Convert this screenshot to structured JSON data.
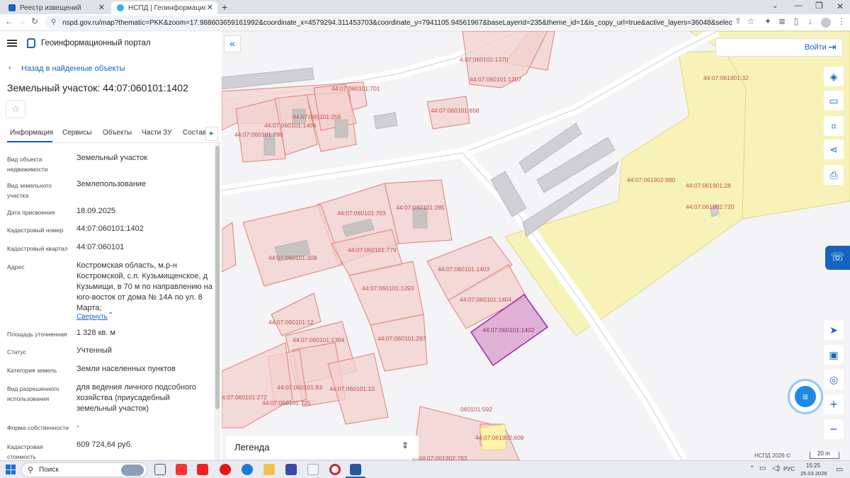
{
  "browser": {
    "tabs": [
      {
        "title": "Реестр извещений",
        "active": false
      },
      {
        "title": "НСПД | Геоинформационный п",
        "active": true
      }
    ],
    "new_tab": "+",
    "url": "nspd.gov.ru/map?thematic=PKK&zoom=17.988603659161992&coordinate_x=4579294.311453703&coordinate_y=7941105.94561967&baseLayerId=235&theme_id=1&is_copy_url=true&active_layers=36048&selectedCard=1084404139%2C3..."
  },
  "header": {
    "title": "Геоинформационный портал",
    "back_link": "Назад в найденные объекты",
    "object_title": "Земельный участок: 44:07:060101:1402",
    "login": "Войти"
  },
  "tabs": [
    {
      "label": "Информация",
      "active": true
    },
    {
      "label": "Сервисы"
    },
    {
      "label": "Объекты"
    },
    {
      "label": "Части ЗУ"
    },
    {
      "label": "Состав"
    }
  ],
  "fields": [
    {
      "label": "Вид объекта недвижимости",
      "value": "Земельный участок"
    },
    {
      "label": "Вид земельного участка",
      "value": "Землепользование"
    },
    {
      "label": "Дата присвоения",
      "value": "18.09.2025"
    },
    {
      "label": "Кадастровый номер",
      "value": "44:07:060101:1402"
    },
    {
      "label": "Кадастровый квартал",
      "value": "44:07:060101"
    },
    {
      "label": "Адрес",
      "value": "Костромская область, м.р-н Костромской, с.п. Кузьмищенское, д Кузьмищи, в 70 м по направлению на юго-восток от дома № 14А по ул. 8 Марта;"
    },
    {
      "label": "Площадь уточненная",
      "value": "1 328 кв. м"
    },
    {
      "label": "Статус",
      "value": "Учтенный"
    },
    {
      "label": "Категория земель",
      "value": "Земли населенных пунктов"
    },
    {
      "label": "Вид разрешенного использования",
      "value": "для ведения личного подсобного хозяйства (приусадебный земельный участок)"
    },
    {
      "label": "Форма собственности",
      "value": "-"
    },
    {
      "label": "Кадастровая стоимость",
      "value": "609 724,64 руб."
    }
  ],
  "collapse_link": "Свернуть",
  "map": {
    "legend": "Легенда",
    "attribution": "НСПД 2026 ©",
    "scale": "20 m",
    "parcels": [
      {
        "id": "a1370",
        "label": "4:07:060101:1370"
      },
      {
        "id": "a1307",
        "label": "44:07:060101:1307"
      },
      {
        "id": "a701",
        "label": "44:07:060101:701"
      },
      {
        "id": "a256",
        "label": "44:07:060101:256"
      },
      {
        "id": "a1406",
        "label": "44:07:060101:1406"
      },
      {
        "id": "a786",
        "label": "44:07:060101:786"
      },
      {
        "id": "a658",
        "label": "44:07:060101:658"
      },
      {
        "id": "a32",
        "label": "44:07:061901:32"
      },
      {
        "id": "a980",
        "label": "44:07:061902:980"
      },
      {
        "id": "a28",
        "label": "44:07:061901:28"
      },
      {
        "id": "a720",
        "label": "44:07:061902:720"
      },
      {
        "id": "a703",
        "label": "44:07:060101:703"
      },
      {
        "id": "a285",
        "label": "44:07:060101:285"
      },
      {
        "id": "a308",
        "label": "44:07:060101:308"
      },
      {
        "id": "a779",
        "label": "44:07:060101:779"
      },
      {
        "id": "a1403",
        "label": "44:07:060101:1403"
      },
      {
        "id": "a1293",
        "label": "44:07:060101:1293"
      },
      {
        "id": "a1404",
        "label": "44:07:060101:1404"
      },
      {
        "id": "a12",
        "label": "44:07:060101:12"
      },
      {
        "id": "a1402",
        "label": "44:07:060101:1402"
      },
      {
        "id": "a1394",
        "label": "44:07:060101:1394"
      },
      {
        "id": "a297",
        "label": "44:07:060101:297"
      },
      {
        "id": "a83",
        "label": "44:07:060101:83"
      },
      {
        "id": "a10",
        "label": "44:07:060101:10"
      },
      {
        "id": "a272",
        "label": "4:07:060101:272"
      },
      {
        "id": "a725",
        "label": "44:07:060101:725"
      },
      {
        "id": "a592",
        "label": "060101:592"
      },
      {
        "id": "a609",
        "label": "44:07:061902:609"
      },
      {
        "id": "a763",
        "label": "44:07:061902:763"
      }
    ]
  },
  "taskbar": {
    "search": "Поиск",
    "lang": "РУС",
    "time": "15:25",
    "date": "25.03.2026"
  },
  "colors": {
    "accent": "#1565c0",
    "parcel": "#e8a09a",
    "selected": "#9c27b0",
    "zone": "#f7f3b8"
  }
}
